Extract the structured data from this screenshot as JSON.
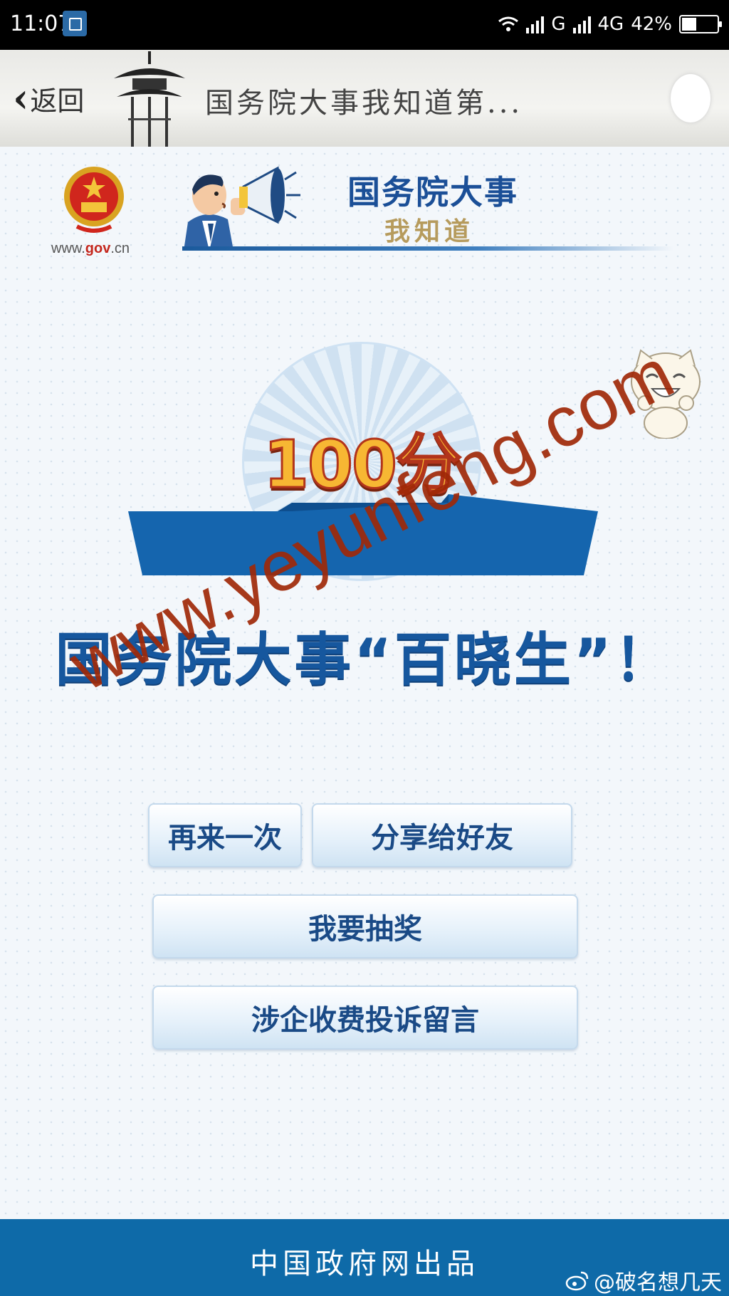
{
  "status_bar": {
    "time": "11:07",
    "network_g": "G",
    "network_4g": "4G",
    "battery_percent": "42%",
    "battery_level": 0.42
  },
  "nav": {
    "back_label": "返回",
    "title": "国务院大事我知道第..."
  },
  "banner": {
    "site_url_prefix": "www.",
    "site_url_brand": "gov",
    "site_url_suffix": ".cn",
    "title": "国务院大事",
    "subtitle": "我知道"
  },
  "result": {
    "score": "100分",
    "headline": "国务院大事“百晓生”！"
  },
  "buttons": {
    "retry": "再来一次",
    "share": "分享给好友",
    "lottery": "我要抽奖",
    "complaint": "涉企收费投诉留言"
  },
  "footer": {
    "text": "中国政府网出品"
  },
  "overlay": {
    "watermark": "www.yeyunfeng.com",
    "weibo_credit": "@破名想几天"
  },
  "colors": {
    "primary_blue": "#16579e",
    "footer_blue": "#0e6aa8",
    "score_gold": "#f7b733",
    "watermark_red": "#a02808"
  }
}
